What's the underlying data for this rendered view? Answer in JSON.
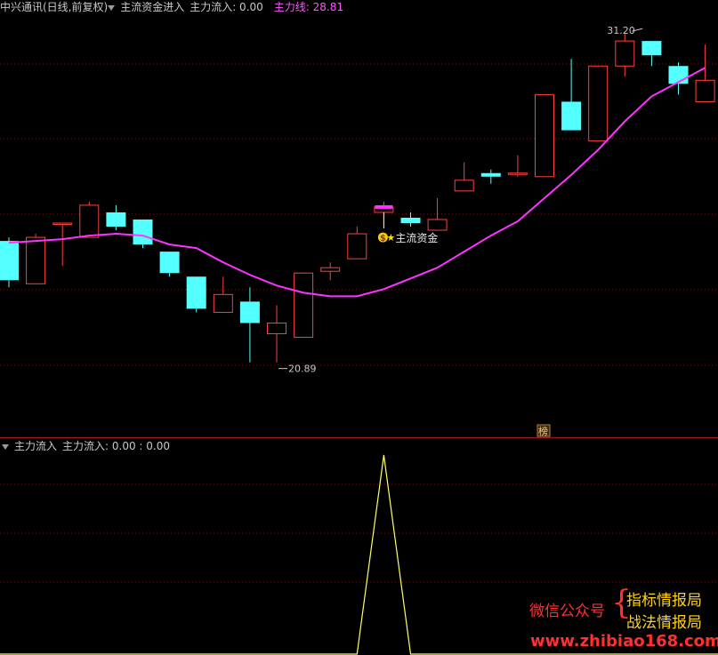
{
  "header_top": {
    "title": "中兴通讯(日线,前复权)",
    "indicator": "主流资金进入",
    "flow_label": "主力流入: 0.00",
    "line_label": "主力线: 28.81"
  },
  "header_bottom": {
    "indicator": "主力流入",
    "flow_label": "主力流入: 0.00 : 0.00"
  },
  "colors": {
    "up": "#ff4040",
    "down": "#54ffff",
    "ma": "#ff33ff",
    "signal": "#ffff66",
    "grid": "#7a1010",
    "text": "#c8c8c8",
    "magenta_label": "#ff55ff"
  },
  "chart_data": [
    {
      "type": "candlestick",
      "ylim": [
        20.0,
        31.8
      ],
      "candles": [
        {
          "o": 25.4,
          "h": 25.5,
          "l": 24.1,
          "c": 24.3
        },
        {
          "o": 24.2,
          "h": 25.6,
          "l": 24.2,
          "c": 25.5
        },
        {
          "o": 25.9,
          "h": 25.9,
          "l": 24.7,
          "c": 25.9
        },
        {
          "o": 25.5,
          "h": 26.5,
          "l": 25.5,
          "c": 26.4
        },
        {
          "o": 26.2,
          "h": 26.4,
          "l": 25.7,
          "c": 25.8
        },
        {
          "o": 26.0,
          "h": 26.0,
          "l": 25.2,
          "c": 25.3
        },
        {
          "o": 25.1,
          "h": 25.1,
          "l": 24.4,
          "c": 24.5
        },
        {
          "o": 24.4,
          "h": 24.4,
          "l": 23.4,
          "c": 23.5
        },
        {
          "o": 23.4,
          "h": 24.4,
          "l": 23.4,
          "c": 23.9
        },
        {
          "o": 23.7,
          "h": 24.1,
          "l": 22.0,
          "c": 23.1
        },
        {
          "o": 22.8,
          "h": 23.6,
          "l": 22.0,
          "c": 23.1
        },
        {
          "o": 22.7,
          "h": 24.5,
          "l": 22.7,
          "c": 24.5
        },
        {
          "o": 24.55,
          "h": 24.8,
          "l": 24.3,
          "c": 24.65
        },
        {
          "o": 24.9,
          "h": 25.8,
          "l": 24.9,
          "c": 25.6
        },
        {
          "o": 26.2,
          "h": 26.5,
          "l": 25.8,
          "c": 26.35
        },
        {
          "o": 26.05,
          "h": 26.2,
          "l": 25.8,
          "c": 25.9
        },
        {
          "o": 25.7,
          "h": 26.6,
          "l": 25.7,
          "c": 26.0
        },
        {
          "o": 26.8,
          "h": 27.6,
          "l": 26.8,
          "c": 27.1
        },
        {
          "o": 27.3,
          "h": 27.4,
          "l": 27.0,
          "c": 27.2
        },
        {
          "o": 27.3,
          "h": 27.8,
          "l": 27.2,
          "c": 27.3
        },
        {
          "o": 27.2,
          "h": 29.5,
          "l": 27.2,
          "c": 29.5
        },
        {
          "o": 29.3,
          "h": 30.5,
          "l": 28.5,
          "c": 28.5
        },
        {
          "o": 28.2,
          "h": 30.3,
          "l": 28.2,
          "c": 30.3
        },
        {
          "o": 30.3,
          "h": 31.2,
          "l": 30.0,
          "c": 31.0
        },
        {
          "o": 31.0,
          "h": 31.0,
          "l": 30.3,
          "c": 30.6
        },
        {
          "o": 30.3,
          "h": 30.4,
          "l": 29.5,
          "c": 29.8
        },
        {
          "o": 29.3,
          "h": 30.9,
          "l": 29.3,
          "c": 29.9
        }
      ],
      "ma_line": [
        25.35,
        25.4,
        25.45,
        25.55,
        25.6,
        25.55,
        25.3,
        25.2,
        24.8,
        24.45,
        24.15,
        23.95,
        23.85,
        23.85,
        24.05,
        24.35,
        24.65,
        25.1,
        25.55,
        25.95,
        26.6,
        27.25,
        27.95,
        28.75,
        29.45,
        29.85,
        30.25
      ],
      "annotations": {
        "high_label": "31.20",
        "low_label": "20.89",
        "signal_text": "主流资金",
        "signal_coin": "$",
        "signal_star": "★",
        "badge_text": "榜"
      }
    },
    {
      "type": "line",
      "name": "",
      "ylim": [
        0,
        1
      ],
      "values": [
        0,
        0,
        0,
        0,
        0,
        0,
        0,
        0,
        0,
        0,
        0,
        0,
        0,
        0,
        1,
        0,
        0,
        0,
        0,
        0,
        0,
        0,
        0,
        0,
        0,
        0,
        0
      ]
    }
  ],
  "watermark": {
    "wechat": "微信公众号",
    "brace": "{",
    "line1": "指标情报局",
    "line2": "战法情报局",
    "url": "www.zhibiao168.com"
  }
}
